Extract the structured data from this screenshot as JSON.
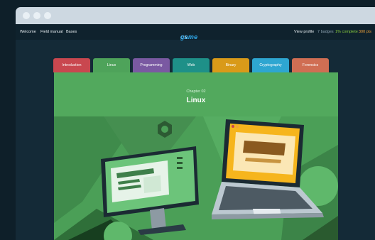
{
  "nav": {
    "links": [
      "Welcome",
      "Field manual",
      "Bases"
    ],
    "logo_cs": "cs",
    "logo_game": "game",
    "view_profile": "View profile",
    "badges": "7 badges",
    "complete": "1% complete",
    "points": "300 pts"
  },
  "tabs": [
    {
      "label": "Introduction",
      "color": "#c9474f"
    },
    {
      "label": "Linux",
      "color": "#4ea35a"
    },
    {
      "label": "Programming",
      "color": "#7a59a2"
    },
    {
      "label": "Web",
      "color": "#1e9088"
    },
    {
      "label": "Binary",
      "color": "#d99a19"
    },
    {
      "label": "Cryptography",
      "color": "#2ea6d1"
    },
    {
      "label": "Forensics",
      "color": "#d06e53"
    }
  ],
  "chapter": {
    "label": "Chapter 02",
    "title": "Linux"
  },
  "colors": {
    "accent_blue": "#2fa8ea",
    "badge_green": "#8bcf3f",
    "points_orange": "#f0a33a"
  }
}
